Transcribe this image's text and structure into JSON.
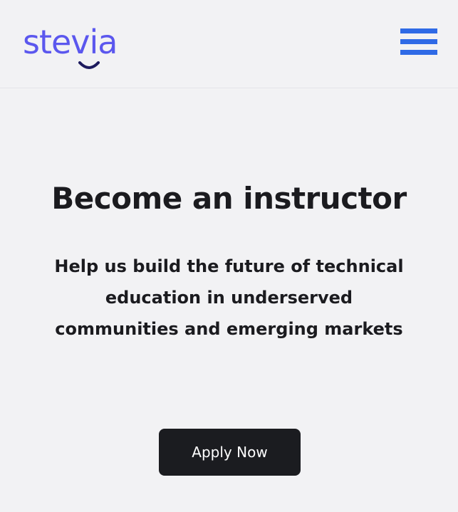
{
  "header": {
    "logo_text": "stevia",
    "menu_icon": "hamburger-menu-icon",
    "colors": {
      "logo": "#5b57ee",
      "menu": "#2f6ae6"
    }
  },
  "hero": {
    "title": "Become an instructor",
    "subtitle_lines": [
      "Help us build the future of technical",
      "education in underserved",
      "communities and emerging markets"
    ],
    "cta_label": "Apply Now"
  },
  "colors": {
    "background": "#f2f2f4",
    "text": "#1b1b1f",
    "button": "#1b1c20"
  }
}
